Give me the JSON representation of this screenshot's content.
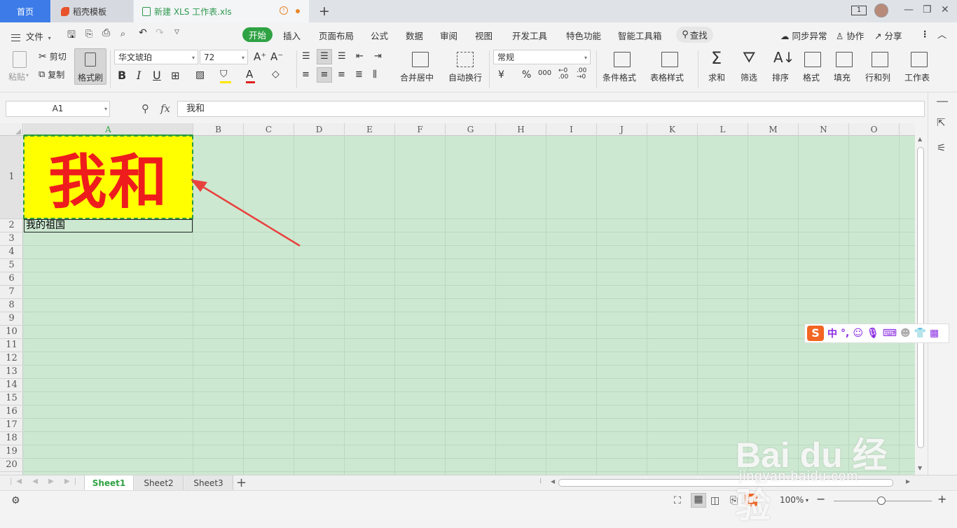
{
  "tabs": {
    "home": "首页",
    "template": "稻壳模板",
    "file": "新建 XLS 工作表.xls",
    "add": "+"
  },
  "window": {
    "badge": "1",
    "minimize": "—",
    "restore": "❐",
    "close": "✕"
  },
  "menu": {
    "file": "文件",
    "items": [
      "开始",
      "插入",
      "页面布局",
      "公式",
      "数据",
      "审阅",
      "视图",
      "开发工具",
      "特色功能",
      "智能工具箱"
    ],
    "search": "查找",
    "sync": "同步异常",
    "collab": "协作",
    "share": "分享"
  },
  "ribbon": {
    "paste": "粘贴",
    "cut": "剪切",
    "copy": "复制",
    "format_painter": "格式刷",
    "font_name": "华文琥珀",
    "font_size": "72",
    "merge_center": "合并居中",
    "wrap_text": "自动换行",
    "number_format": "常规",
    "currency": "¥",
    "percent": "%",
    "thousands": "000",
    "cond_format": "条件格式",
    "table_style": "表格样式",
    "sum": "求和",
    "filter": "筛选",
    "sort": "排序",
    "format": "格式",
    "fill": "填充",
    "row_col": "行和列",
    "worksheet": "工作表"
  },
  "formula_bar": {
    "name_box": "A1",
    "fx": "fx",
    "value": "我和"
  },
  "columns": [
    "A",
    "B",
    "C",
    "D",
    "E",
    "F",
    "G",
    "H",
    "I",
    "J",
    "K",
    "L",
    "M",
    "N",
    "O"
  ],
  "rows": [
    "1",
    "2",
    "3",
    "4",
    "5",
    "6",
    "7",
    "8",
    "9",
    "10",
    "11",
    "12",
    "13",
    "14",
    "15",
    "16",
    "17",
    "18",
    "19",
    "20"
  ],
  "cells": {
    "A1": "我和",
    "A2": "我的祖国"
  },
  "sheets": [
    "Sheet1",
    "Sheet2",
    "Sheet3"
  ],
  "status": {
    "zoom": "100%"
  },
  "ime": {
    "lang": "中"
  },
  "watermark": {
    "brand": "Bai du 经验",
    "url": "jingyan.baidu.com"
  },
  "colors": {
    "accent": "#2fa244",
    "cell_fill": "#ffff00",
    "cell_text": "#ee1c1c",
    "grid_bg": "#cde8d1",
    "arrow": "#e8423f"
  }
}
